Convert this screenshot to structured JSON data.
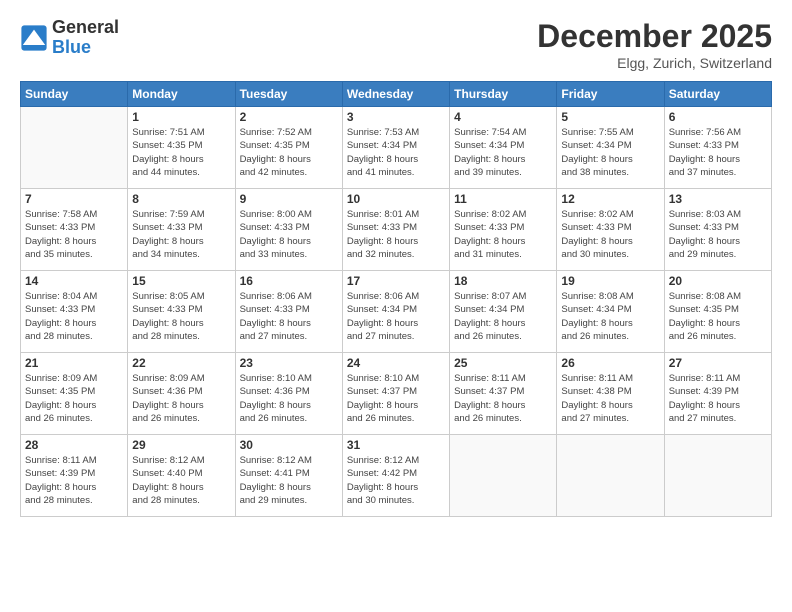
{
  "header": {
    "logo_general": "General",
    "logo_blue": "Blue",
    "month_title": "December 2025",
    "location": "Elgg, Zurich, Switzerland"
  },
  "days_of_week": [
    "Sunday",
    "Monday",
    "Tuesday",
    "Wednesday",
    "Thursday",
    "Friday",
    "Saturday"
  ],
  "weeks": [
    [
      {
        "day": "",
        "info": ""
      },
      {
        "day": "1",
        "info": "Sunrise: 7:51 AM\nSunset: 4:35 PM\nDaylight: 8 hours\nand 44 minutes."
      },
      {
        "day": "2",
        "info": "Sunrise: 7:52 AM\nSunset: 4:35 PM\nDaylight: 8 hours\nand 42 minutes."
      },
      {
        "day": "3",
        "info": "Sunrise: 7:53 AM\nSunset: 4:34 PM\nDaylight: 8 hours\nand 41 minutes."
      },
      {
        "day": "4",
        "info": "Sunrise: 7:54 AM\nSunset: 4:34 PM\nDaylight: 8 hours\nand 39 minutes."
      },
      {
        "day": "5",
        "info": "Sunrise: 7:55 AM\nSunset: 4:34 PM\nDaylight: 8 hours\nand 38 minutes."
      },
      {
        "day": "6",
        "info": "Sunrise: 7:56 AM\nSunset: 4:33 PM\nDaylight: 8 hours\nand 37 minutes."
      }
    ],
    [
      {
        "day": "7",
        "info": "Sunrise: 7:58 AM\nSunset: 4:33 PM\nDaylight: 8 hours\nand 35 minutes."
      },
      {
        "day": "8",
        "info": "Sunrise: 7:59 AM\nSunset: 4:33 PM\nDaylight: 8 hours\nand 34 minutes."
      },
      {
        "day": "9",
        "info": "Sunrise: 8:00 AM\nSunset: 4:33 PM\nDaylight: 8 hours\nand 33 minutes."
      },
      {
        "day": "10",
        "info": "Sunrise: 8:01 AM\nSunset: 4:33 PM\nDaylight: 8 hours\nand 32 minutes."
      },
      {
        "day": "11",
        "info": "Sunrise: 8:02 AM\nSunset: 4:33 PM\nDaylight: 8 hours\nand 31 minutes."
      },
      {
        "day": "12",
        "info": "Sunrise: 8:02 AM\nSunset: 4:33 PM\nDaylight: 8 hours\nand 30 minutes."
      },
      {
        "day": "13",
        "info": "Sunrise: 8:03 AM\nSunset: 4:33 PM\nDaylight: 8 hours\nand 29 minutes."
      }
    ],
    [
      {
        "day": "14",
        "info": "Sunrise: 8:04 AM\nSunset: 4:33 PM\nDaylight: 8 hours\nand 28 minutes."
      },
      {
        "day": "15",
        "info": "Sunrise: 8:05 AM\nSunset: 4:33 PM\nDaylight: 8 hours\nand 28 minutes."
      },
      {
        "day": "16",
        "info": "Sunrise: 8:06 AM\nSunset: 4:33 PM\nDaylight: 8 hours\nand 27 minutes."
      },
      {
        "day": "17",
        "info": "Sunrise: 8:06 AM\nSunset: 4:34 PM\nDaylight: 8 hours\nand 27 minutes."
      },
      {
        "day": "18",
        "info": "Sunrise: 8:07 AM\nSunset: 4:34 PM\nDaylight: 8 hours\nand 26 minutes."
      },
      {
        "day": "19",
        "info": "Sunrise: 8:08 AM\nSunset: 4:34 PM\nDaylight: 8 hours\nand 26 minutes."
      },
      {
        "day": "20",
        "info": "Sunrise: 8:08 AM\nSunset: 4:35 PM\nDaylight: 8 hours\nand 26 minutes."
      }
    ],
    [
      {
        "day": "21",
        "info": "Sunrise: 8:09 AM\nSunset: 4:35 PM\nDaylight: 8 hours\nand 26 minutes."
      },
      {
        "day": "22",
        "info": "Sunrise: 8:09 AM\nSunset: 4:36 PM\nDaylight: 8 hours\nand 26 minutes."
      },
      {
        "day": "23",
        "info": "Sunrise: 8:10 AM\nSunset: 4:36 PM\nDaylight: 8 hours\nand 26 minutes."
      },
      {
        "day": "24",
        "info": "Sunrise: 8:10 AM\nSunset: 4:37 PM\nDaylight: 8 hours\nand 26 minutes."
      },
      {
        "day": "25",
        "info": "Sunrise: 8:11 AM\nSunset: 4:37 PM\nDaylight: 8 hours\nand 26 minutes."
      },
      {
        "day": "26",
        "info": "Sunrise: 8:11 AM\nSunset: 4:38 PM\nDaylight: 8 hours\nand 27 minutes."
      },
      {
        "day": "27",
        "info": "Sunrise: 8:11 AM\nSunset: 4:39 PM\nDaylight: 8 hours\nand 27 minutes."
      }
    ],
    [
      {
        "day": "28",
        "info": "Sunrise: 8:11 AM\nSunset: 4:39 PM\nDaylight: 8 hours\nand 28 minutes."
      },
      {
        "day": "29",
        "info": "Sunrise: 8:12 AM\nSunset: 4:40 PM\nDaylight: 8 hours\nand 28 minutes."
      },
      {
        "day": "30",
        "info": "Sunrise: 8:12 AM\nSunset: 4:41 PM\nDaylight: 8 hours\nand 29 minutes."
      },
      {
        "day": "31",
        "info": "Sunrise: 8:12 AM\nSunset: 4:42 PM\nDaylight: 8 hours\nand 30 minutes."
      },
      {
        "day": "",
        "info": ""
      },
      {
        "day": "",
        "info": ""
      },
      {
        "day": "",
        "info": ""
      }
    ]
  ]
}
